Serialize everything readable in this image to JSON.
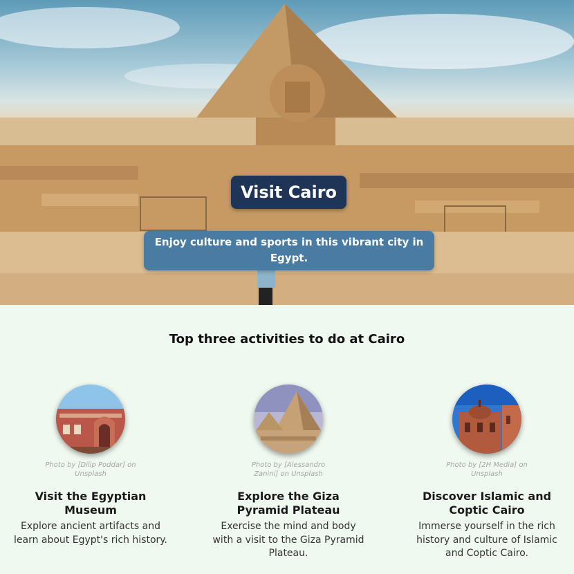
{
  "hero": {
    "title": "Visit Cairo",
    "subtitle": "Enjoy culture and sports in this vibrant city in Egypt."
  },
  "activities": {
    "heading": "Top three activities to do at Cairo",
    "items": [
      {
        "credit": "Photo by [Dilip Poddar] on Unsplash",
        "title": "Visit the Egyptian Museum",
        "description": "Explore ancient artifacts and learn about Egypt's rich history."
      },
      {
        "credit": "Photo by [Alessandro Zanini] on Unsplash",
        "title": "Explore the Giza Pyramid Plateau",
        "description": "Exercise the mind and body with a visit to the Giza Pyramid Plateau."
      },
      {
        "credit": "Photo by [2H Media] on Unsplash",
        "title": "Discover Islamic and Coptic Cairo",
        "description": "Immerse yourself in the rich history and culture of Islamic and Coptic Cairo."
      }
    ]
  },
  "colors": {
    "page_background": "#f0f9f0",
    "title_box": "#1f3557",
    "subtitle_box": "#4a7ba2"
  }
}
